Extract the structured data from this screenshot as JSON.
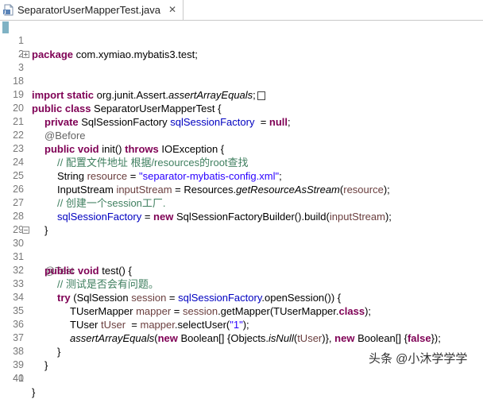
{
  "tab": {
    "title": "SeparatorUserMapperTest.java",
    "close_glyph": "✕"
  },
  "watermark": "头条 @小沐学学学",
  "lines": {
    "l1": {
      "no": "1",
      "kw1": "package",
      "rest": " com.xymiao.mybatis3.test;"
    },
    "l2": {
      "no": "2"
    },
    "l3": {
      "no": "3",
      "kw1": "import static",
      "rest": " org.junit.Assert.",
      "method": "assertArrayEquals",
      "end": ";"
    },
    "l18": {
      "no": "18"
    },
    "l19": {
      "no": "19",
      "kw1": "public class",
      "rest": " SeparatorUserMapperTest {"
    },
    "l20": {
      "no": "20",
      "kw1": "private",
      "type": " SqlSessionFactory ",
      "fld": "sqlSessionFactory",
      "mid": "  = ",
      "kw2": "null",
      "end": ";"
    },
    "l21": {
      "no": "21",
      "ann": "@Before"
    },
    "l22": {
      "no": "22",
      "kw1": "public void",
      "mid": " init() ",
      "kw2": "throws",
      "end": " IOException {"
    },
    "l23": {
      "no": "23",
      "cmt": "// 配置文件地址 根据/resources的root查找"
    },
    "l24": {
      "no": "24",
      "type": "String ",
      "var": "resource",
      "mid": " = ",
      "str": "\"separator-mybatis-config.xml\"",
      "end": ";"
    },
    "l25": {
      "no": "25",
      "type": "InputStream ",
      "var": "inputStream",
      "mid": " = Resources.",
      "method": "getResourceAsStream",
      "open": "(",
      "var2": "resource",
      "end": ");"
    },
    "l26": {
      "no": "26",
      "cmt": "// 创建一个session工厂."
    },
    "l27": {
      "no": "27",
      "fld": "sqlSessionFactory",
      "mid": " = ",
      "kw1": "new",
      "mid2": " SqlSessionFactoryBuilder().build(",
      "var": "inputStream",
      "end": ");"
    },
    "l28": {
      "no": "28",
      "end": "}"
    },
    "l29": {
      "no": "29"
    },
    "l30": {
      "no": "30",
      "ann": "@Test"
    },
    "l31": {
      "no": "31",
      "kw1": "public void",
      "end": " test() {"
    },
    "l32": {
      "no": "32",
      "cmt": "// 测试是否会有问题。"
    },
    "l33": {
      "no": "33",
      "kw1": "try",
      "mid": " (SqlSession ",
      "var": "session",
      "mid2": " = ",
      "fld": "sqlSessionFactory",
      "end": ".openSession()) {"
    },
    "l34": {
      "no": "34",
      "type": "TUserMapper ",
      "var": "mapper",
      "mid": " = ",
      "var2": "session",
      "mid2": ".getMapper(TUserMapper.",
      "kw1": "class",
      "end": ");"
    },
    "l35": {
      "no": "35",
      "type": "TUser ",
      "var": "tUser",
      "mid": "  = ",
      "var2": "mapper",
      "mid2": ".selectUser(",
      "str": "\"1\"",
      "end": ");"
    },
    "l36": {
      "no": "36",
      "method": "assertArrayEquals",
      "open": "(",
      "kw1": "new",
      "mid": " Boolean[] {Objects.",
      "method2": "isNull",
      "open2": "(",
      "var": "tUser",
      "mid2": ")}, ",
      "kw2": "new",
      "mid3": " Boolean[] {",
      "kw3": "false",
      "end": "});"
    },
    "l37": {
      "no": "37",
      "end": "}"
    },
    "l38": {
      "no": "38",
      "end": "}"
    },
    "l39": {
      "no": "39"
    },
    "l40": {
      "no": "40"
    },
    "l41": {
      "no": "41",
      "end": "}"
    }
  },
  "colors": {
    "keyword": "#7f0055",
    "field": "#0000c0",
    "local_var": "#6a3e3e",
    "string": "#2a00ff",
    "comment": "#3f7f5f",
    "annotation": "#646464"
  }
}
